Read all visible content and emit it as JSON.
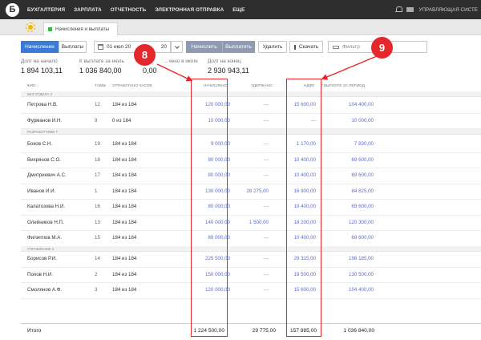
{
  "topbar": {
    "logo": "Б",
    "nav": [
      "БУХГАЛТЕРИЯ",
      "ЗАРПЛАТА",
      "ОТЧЕТНОСТЬ",
      "ЭЛЕКТРОННАЯ ОТПРАВКА",
      "ЕЩЕ"
    ],
    "system_label": "УПРАВЛЯЮЩАЯ СИСТЕ"
  },
  "tabbar": {
    "doc_tab": "Начисления и выплаты"
  },
  "toolbar": {
    "accruals": "Начисление",
    "payouts": "Выплаты",
    "date": "01 июл 20",
    "date_tail": "20",
    "calc": "Начислить",
    "pay": "Выплатить",
    "delete": "Удалить",
    "download": "Скачать",
    "filter_placeholder": "Фильтр"
  },
  "summary": [
    {
      "label": "Долг на начало",
      "value": "1 894 103,11"
    },
    {
      "label": "К выплате за июль",
      "value": "1 036 840,00"
    },
    {
      "label": "...чено в июле",
      "value": "0,00"
    },
    {
      "label": "Долг на конец",
      "value": "2 930 943,11"
    }
  ],
  "table": {
    "headers": {
      "name": "ФИО ↑",
      "tab": "ТАБ№",
      "hours": "ОТРАБОТАНО ЧАСОВ",
      "accrued": "НАЧИСЛЕНО",
      "withheld": "УДЕРЖАНО",
      "ndfl": "НДФЛ",
      "payout": "К ВЫПЛАТЕ ЗА ПЕРИОД"
    },
    "groups": [
      {
        "name": "БЕЗ ОТДЕЛА 3",
        "rows": [
          {
            "name": "Петрова Н.В.",
            "tab": "12",
            "hours": "184 из 184",
            "accrued": "120 000,00",
            "withheld": "—",
            "ndfl": "15 600,00",
            "payout": "104 400,00"
          },
          {
            "name": "Фурманов И.Н.",
            "tab": "9",
            "hours": "0 из 184",
            "accrued": "10 000,00",
            "withheld": "—",
            "ndfl": "—",
            "payout": "10 000,00"
          }
        ]
      },
      {
        "name": "РАЗРАБОТЧИКИ 7",
        "rows": [
          {
            "name": "Боков С.Н.",
            "tab": "19",
            "hours": "184 из 184",
            "accrued": "9 000,00",
            "withheld": "—",
            "ndfl": "1 170,00",
            "payout": "7 830,00"
          },
          {
            "name": "Вихрянов С.О.",
            "tab": "18",
            "hours": "184 из 184",
            "accrued": "80 000,00",
            "withheld": "—",
            "ndfl": "10 400,00",
            "payout": "69 600,00"
          },
          {
            "name": "Дмитриевич А.С.",
            "tab": "17",
            "hours": "184 из 184",
            "accrued": "80 000,00",
            "withheld": "—",
            "ndfl": "10 400,00",
            "payout": "69 600,00"
          },
          {
            "name": "Иванов И.И.",
            "tab": "1",
            "hours": "184 из 184",
            "accrued": "130 000,00",
            "withheld": "28 275,00",
            "ndfl": "16 900,00",
            "payout": "84 825,00"
          },
          {
            "name": "Калатозова Н.И.",
            "tab": "16",
            "hours": "184 из 184",
            "accrued": "80 000,00",
            "withheld": "—",
            "ndfl": "10 400,00",
            "payout": "69 600,00"
          },
          {
            "name": "Олейников Н.П.",
            "tab": "13",
            "hours": "184 из 184",
            "accrued": "140 000,00",
            "withheld": "1 500,00",
            "ndfl": "18 200,00",
            "payout": "120 300,00"
          },
          {
            "name": "Филиппов М.А.",
            "tab": "15",
            "hours": "184 из 184",
            "accrued": "80 000,00",
            "withheld": "—",
            "ndfl": "10 400,00",
            "payout": "69 600,00"
          }
        ]
      },
      {
        "name": "УПРАВЛЕНИЕ 3",
        "rows": [
          {
            "name": "Борисов Р.И.",
            "tab": "14",
            "hours": "184 из 184",
            "accrued": "225 500,00",
            "withheld": "—",
            "ndfl": "29 315,00",
            "payout": "196 185,00"
          },
          {
            "name": "Попов Н.И.",
            "tab": "2",
            "hours": "184 из 184",
            "accrued": "150 000,00",
            "withheld": "—",
            "ndfl": "19 500,00",
            "payout": "130 500,00"
          },
          {
            "name": "Смолянов А.Ф.",
            "tab": "3",
            "hours": "184 из 184",
            "accrued": "120 000,00",
            "withheld": "—",
            "ndfl": "15 600,00",
            "payout": "104 400,00"
          }
        ]
      }
    ],
    "totals": {
      "label": "Итого",
      "accrued": "1 224 500,00",
      "withheld": "29 775,00",
      "ndfl": "157 885,00",
      "payout": "1 036 840,00"
    }
  },
  "annotations": {
    "callout_accrued": "8",
    "callout_ndfl": "9",
    "color": "#e5262b"
  }
}
